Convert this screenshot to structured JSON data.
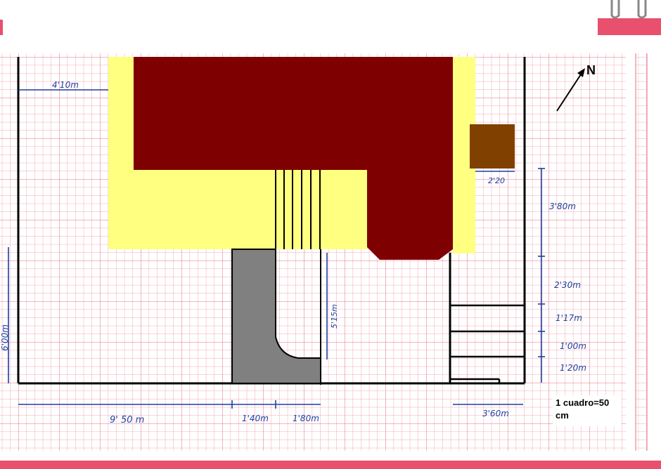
{
  "colors": {
    "paper": "#ffffff",
    "grid": "#f2a7b4",
    "grid_major": "#e46f85",
    "house": "#7f0000",
    "terrace": "#ffff80",
    "path": "#808080",
    "shed": "#804000",
    "wall": "#000000",
    "ink": "#1f3f9f",
    "binding": "#e8506d"
  },
  "dimensions": {
    "d410": "4'10m",
    "d220": "2'20",
    "d380": "3'80m",
    "d230": "2'30m",
    "d117": "1'17m",
    "d100": "1'00m",
    "d120": "1'20m",
    "d600": "6'00m",
    "d515": "5'15m",
    "d950": "9' 50 m",
    "d140": "1'40m",
    "d180": "1'80m",
    "d360": "3'60m"
  },
  "compass": {
    "north_label": "N",
    "icon": "north-arrow-icon"
  },
  "legend": {
    "scale_text": "1 cuadro=50 cm"
  }
}
